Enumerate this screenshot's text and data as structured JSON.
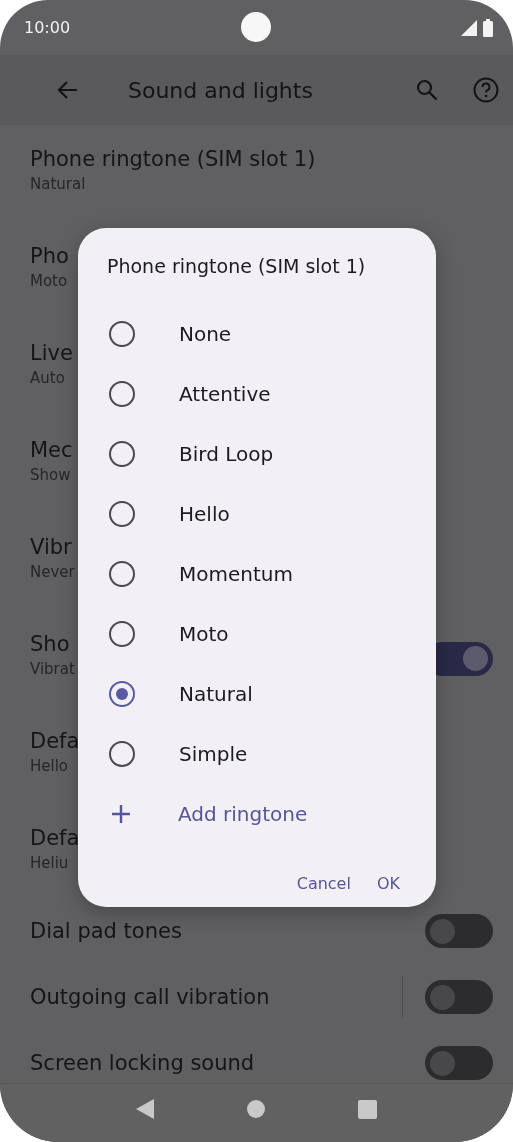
{
  "status_bar": {
    "time": "10:00"
  },
  "toolbar": {
    "title": "Sound and lights"
  },
  "settings": [
    {
      "title": "Phone ringtone (SIM slot 1)",
      "subtitle": "Natural"
    },
    {
      "title": "Pho",
      "subtitle": "Moto"
    },
    {
      "title": "Live",
      "subtitle": "Auto"
    },
    {
      "title": "Mec",
      "subtitle": "Show"
    },
    {
      "title": "Vibr",
      "subtitle": "Never"
    },
    {
      "title": "Sho",
      "subtitle": "Vibrat",
      "switch": {
        "on": true,
        "divider": false
      }
    },
    {
      "title": "Defa",
      "subtitle": "Hello"
    },
    {
      "title": "Defa",
      "subtitle": "Heliu"
    },
    {
      "title": "Dial pad tones",
      "switch": {
        "on": false,
        "divider": false
      }
    },
    {
      "title": "Outgoing call vibration",
      "switch": {
        "on": false,
        "divider": true
      }
    },
    {
      "title": "Screen locking sound",
      "switch": {
        "on": false,
        "divider": false
      }
    }
  ],
  "dialog": {
    "title": "Phone ringtone (SIM slot 1)",
    "options": [
      {
        "label": "None",
        "selected": false
      },
      {
        "label": "Attentive",
        "selected": false
      },
      {
        "label": "Bird Loop",
        "selected": false
      },
      {
        "label": "Hello",
        "selected": false
      },
      {
        "label": "Momentum",
        "selected": false
      },
      {
        "label": "Moto",
        "selected": false
      },
      {
        "label": "Natural",
        "selected": true
      },
      {
        "label": "Simple",
        "selected": false
      }
    ],
    "add_action": {
      "label": "Add ringtone"
    },
    "buttons": [
      "Cancel",
      "OK"
    ]
  }
}
